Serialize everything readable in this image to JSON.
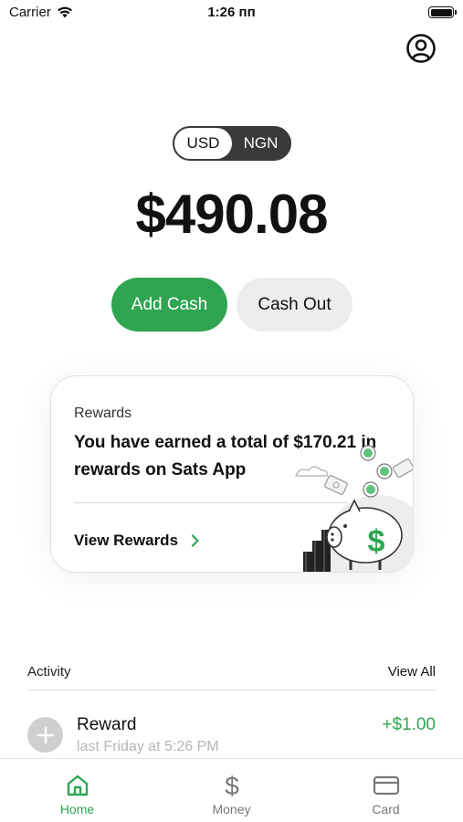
{
  "status_bar": {
    "carrier": "Carrier",
    "time": "1:26 пп"
  },
  "currency_toggle": {
    "selected": "USD",
    "options": [
      "USD",
      "NGN"
    ]
  },
  "balance": "$490.08",
  "actions": {
    "add_cash": "Add Cash",
    "cash_out": "Cash Out"
  },
  "rewards": {
    "title": "Rewards",
    "message": "You have earned a total of $170.21 in rewards on Sats App",
    "link": "View Rewards"
  },
  "activity": {
    "label": "Activity",
    "view_all": "View All",
    "items": [
      {
        "title": "Reward",
        "subtitle": "last Friday at 5:26 PM",
        "amount": "+$1.00"
      }
    ]
  },
  "tabs": [
    {
      "label": "Home",
      "icon": "home-icon",
      "active": true
    },
    {
      "label": "Money",
      "icon": "dollar-icon",
      "active": false
    },
    {
      "label": "Card",
      "icon": "card-icon",
      "active": false
    }
  ],
  "colors": {
    "accent": "#2fa552",
    "toggle_dark": "#3a3a3a",
    "muted": "#777777"
  }
}
